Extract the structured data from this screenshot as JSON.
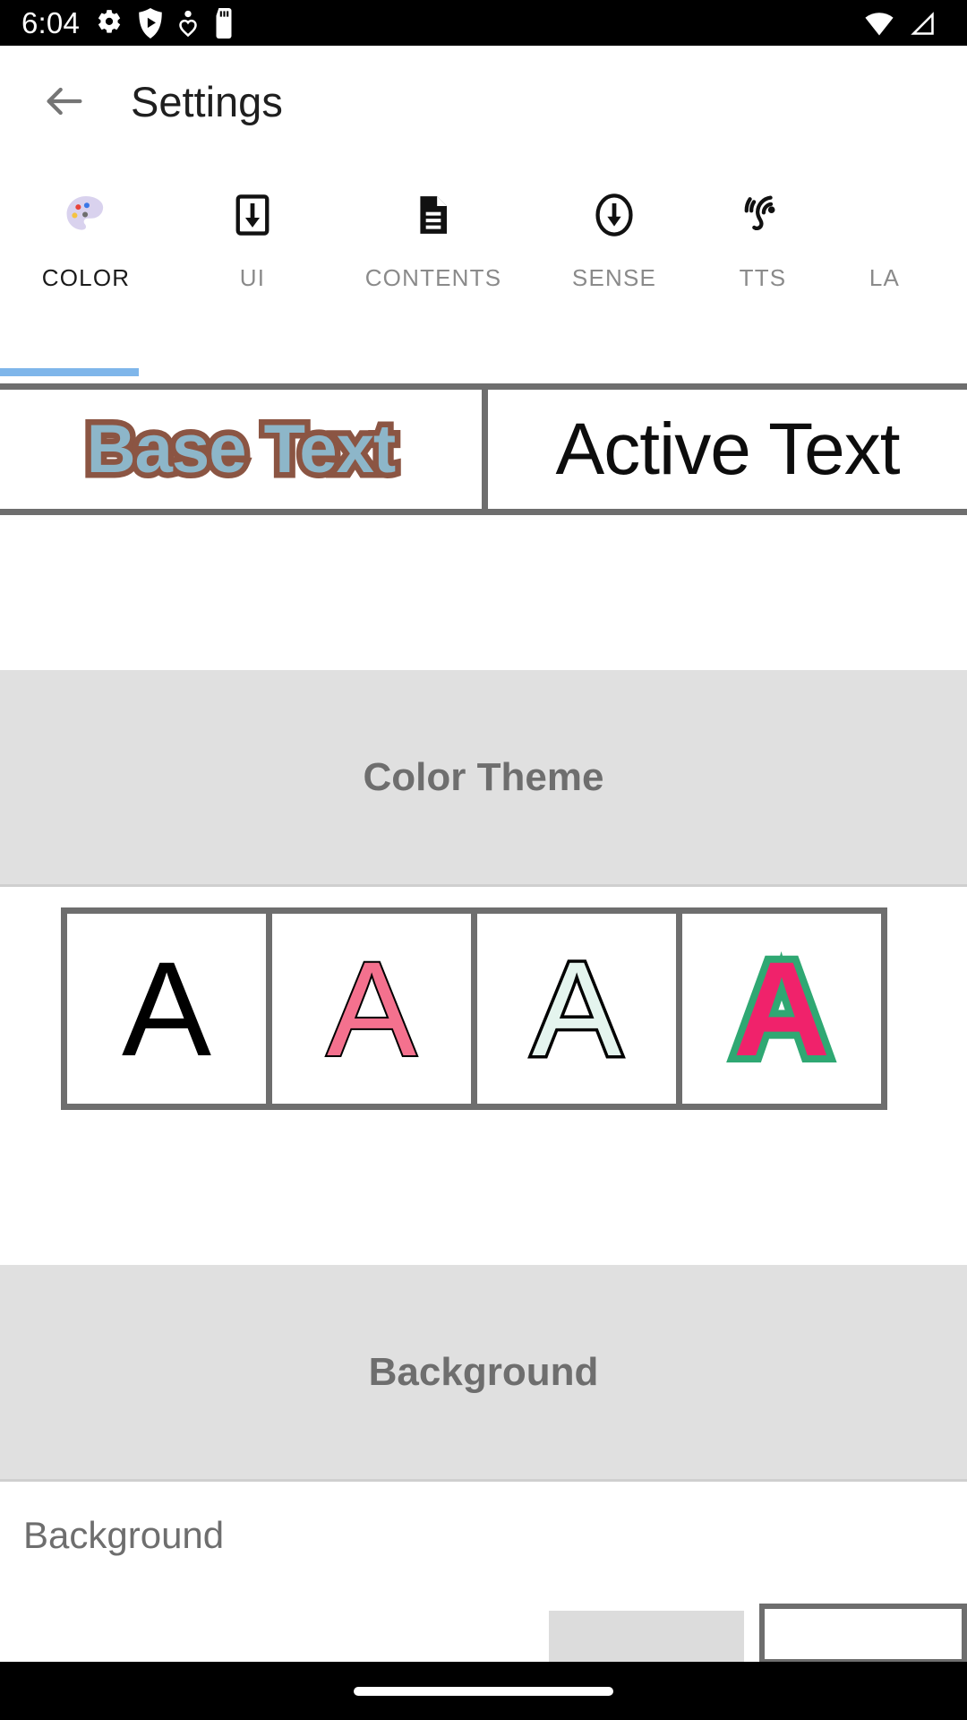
{
  "status_bar": {
    "time": "6:04",
    "left_icons": [
      "gear-icon",
      "shield-play-icon",
      "heart-pin-icon",
      "sd-card-icon"
    ],
    "right_icons": [
      "wifi-icon",
      "cell-signal-icon"
    ],
    "background_color": "#000000",
    "foreground_color": "#ffffff"
  },
  "app_bar": {
    "back_icon": "back-arrow-icon",
    "title": "Settings"
  },
  "tabs": {
    "active_index": 0,
    "indicator_color": "#7fb6ea",
    "items": [
      {
        "label": "COLOR",
        "icon": "palette-icon",
        "active": true
      },
      {
        "label": "UI",
        "icon": "download-box-icon",
        "active": false
      },
      {
        "label": "CONTENTS",
        "icon": "document-lines-icon",
        "active": false
      },
      {
        "label": "SENSE",
        "icon": "arrow-down-circle-icon",
        "active": false
      },
      {
        "label": "TTS",
        "icon": "ear-hearing-icon",
        "active": false
      },
      {
        "label": "LA",
        "icon": "",
        "active": false
      }
    ]
  },
  "preview": {
    "base": {
      "text": "Base Text",
      "fill_color": "#8db6c9",
      "stroke_color": "#8b5543"
    },
    "active": {
      "text": "Active Text",
      "fill_color": "#0d0d0d"
    },
    "border_color": "#6e6e6e"
  },
  "sections": [
    {
      "id": "color_theme",
      "title": "Color Theme"
    },
    {
      "id": "background",
      "title": "Background"
    }
  ],
  "color_theme": {
    "title": "Color Theme",
    "swatch_glyph": "A",
    "swatches": [
      {
        "name": "theme-black",
        "fill": "#000000",
        "stroke": "#000000"
      },
      {
        "name": "theme-pink",
        "fill": "#f4718e",
        "stroke": "#000000"
      },
      {
        "name": "theme-mint",
        "fill": "#e4f4ee",
        "stroke": "#000000"
      },
      {
        "name": "theme-pink-green",
        "fill": "#f0226b",
        "stroke": "#2fa873"
      }
    ]
  },
  "background_section": {
    "title": "Background",
    "row_label": "Background"
  },
  "nav_bar": {
    "home_indicator": "home-pill-indicator"
  }
}
